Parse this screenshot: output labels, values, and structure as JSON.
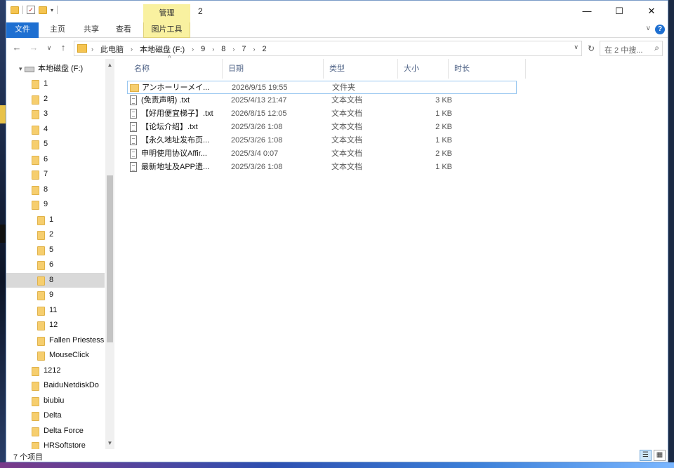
{
  "window": {
    "title": "2",
    "contextual_tab_group": "管理",
    "controls": {
      "minimize": "—",
      "maximize": "☐",
      "close": "✕"
    }
  },
  "ribbon": {
    "tabs": [
      "文件",
      "主页",
      "共享",
      "查看",
      "图片工具"
    ],
    "collapse_icon": "chevron-down-icon",
    "help_label": "?"
  },
  "nav": {
    "back": "←",
    "forward": "→",
    "recent": "∨",
    "up": "↑",
    "breadcrumbs": [
      "此电脑",
      "本地磁盘 (F:)",
      "9",
      "8",
      "7",
      "2"
    ],
    "refresh": "↻",
    "search_placeholder": "在 2 中搜...",
    "search_icon": "⌕"
  },
  "tree": {
    "drive": "本地磁盘 (F:)",
    "items": [
      {
        "label": "1",
        "level": 1
      },
      {
        "label": "2",
        "level": 1
      },
      {
        "label": "3",
        "level": 1
      },
      {
        "label": "4",
        "level": 1
      },
      {
        "label": "5",
        "level": 1
      },
      {
        "label": "6",
        "level": 1
      },
      {
        "label": "7",
        "level": 1
      },
      {
        "label": "8",
        "level": 1
      },
      {
        "label": "9",
        "level": 1
      },
      {
        "label": "1",
        "level": 2
      },
      {
        "label": "2",
        "level": 2
      },
      {
        "label": "5",
        "level": 2
      },
      {
        "label": "6",
        "level": 2
      },
      {
        "label": "8",
        "level": 2,
        "selected": true
      },
      {
        "label": "9",
        "level": 2
      },
      {
        "label": "11",
        "level": 2
      },
      {
        "label": "12",
        "level": 2
      },
      {
        "label": "Fallen Priestess",
        "level": 2
      },
      {
        "label": "MouseClick",
        "level": 2
      },
      {
        "label": "1212",
        "level": 1
      },
      {
        "label": "BaiduNetdiskDo",
        "level": 1
      },
      {
        "label": "biubiu",
        "level": 1
      },
      {
        "label": "Delta",
        "level": 1
      },
      {
        "label": "Delta Force",
        "level": 1
      },
      {
        "label": "HRSoftstore",
        "level": 1
      }
    ]
  },
  "columns": [
    "名称",
    "日期",
    "类型",
    "大小",
    "时长"
  ],
  "files": [
    {
      "name": "アンホーリーメイ...",
      "date": "2026/9/15 19:55",
      "type": "文件夹",
      "size": "",
      "kind": "folder",
      "selected": true
    },
    {
      "name": "(免责声明) .txt",
      "date": "2025/4/13 21:47",
      "type": "文本文档",
      "size": "3 KB",
      "kind": "doc"
    },
    {
      "name": "【好用便宜梯子】.txt",
      "date": "2026/8/15 12:05",
      "type": "文本文档",
      "size": "1 KB",
      "kind": "doc"
    },
    {
      "name": "【论坛介绍】.txt",
      "date": "2025/3/26 1:08",
      "type": "文本文档",
      "size": "2 KB",
      "kind": "doc"
    },
    {
      "name": "【永久地址发布页...",
      "date": "2025/3/26 1:08",
      "type": "文本文档",
      "size": "1 KB",
      "kind": "doc"
    },
    {
      "name": "申明使用协议Affir...",
      "date": "2025/3/4 0:07",
      "type": "文本文档",
      "size": "2 KB",
      "kind": "doc"
    },
    {
      "name": "最新地址及APP遗...",
      "date": "2025/3/26 1:08",
      "type": "文本文档",
      "size": "1 KB",
      "kind": "doc"
    }
  ],
  "status": {
    "count": "7 个项目"
  },
  "views": {
    "details": "☰",
    "tiles": "▦"
  }
}
